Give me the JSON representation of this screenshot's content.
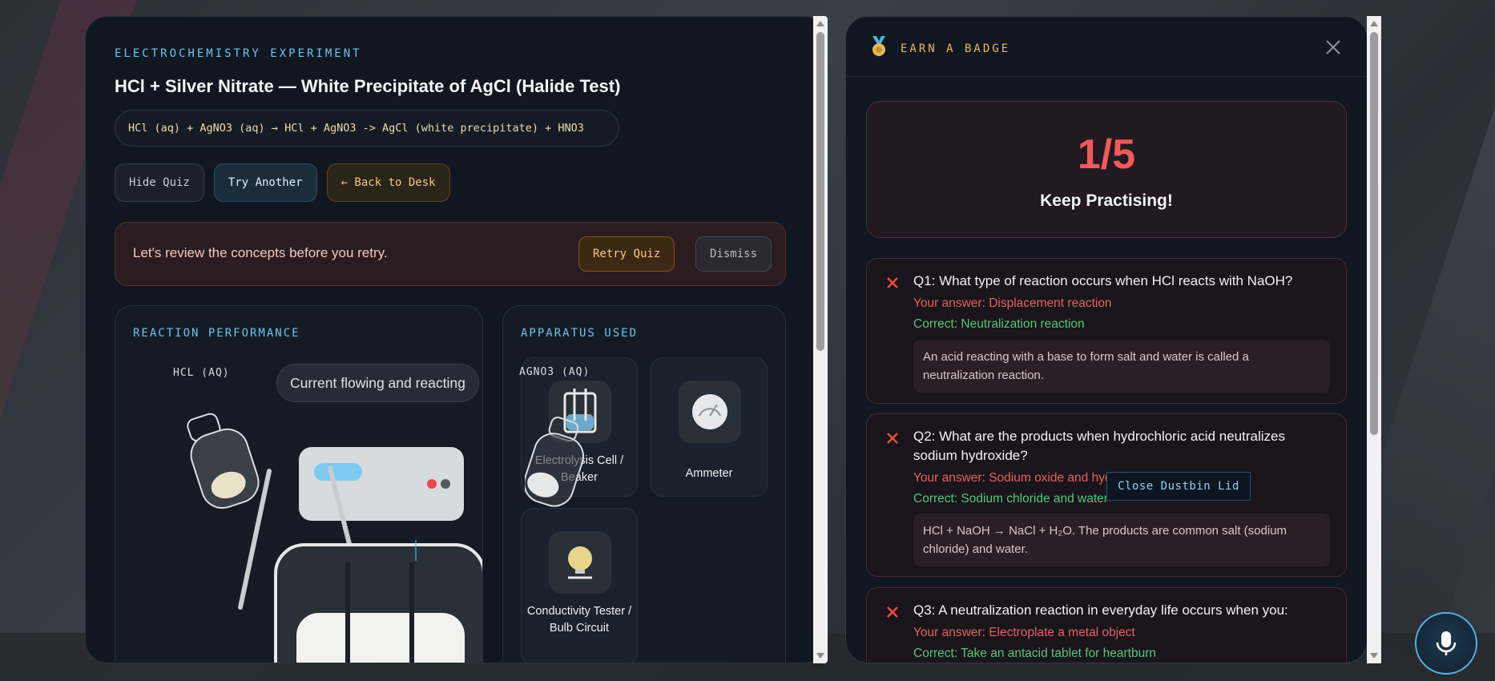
{
  "experiment": {
    "eyebrow": "ELECTROCHEMISTRY EXPERIMENT",
    "title": "HCl + Silver Nitrate — White Precipitate of AgCl (Halide Test)",
    "equation": "HCl (aq) + AgNO3 (aq) → HCl + AgNO3 -> AgCl (white precipitate) + HNO3",
    "buttons": {
      "hide_quiz": "Hide Quiz",
      "try_another": "Try Another",
      "back_to_desk": "← Back to Desk"
    },
    "alert": {
      "text": "Let's review the concepts before you retry.",
      "retry": "Retry Quiz",
      "dismiss": "Dismiss"
    },
    "performance": {
      "heading": "REACTION PERFORMANCE",
      "left_label": "HCL (AQ)",
      "right_label": "AGNO3 (AQ)",
      "status": "Current flowing and reacting"
    },
    "apparatus": {
      "heading": "APPARATUS USED",
      "items": [
        {
          "label": "Electrolysis Cell / Beaker",
          "icon": "electrolysis-cell-icon"
        },
        {
          "label": "Ammeter",
          "icon": "ammeter-icon"
        },
        {
          "label": "Conductivity Tester / Bulb Circuit",
          "icon": "bulb-circuit-icon"
        }
      ]
    }
  },
  "quiz": {
    "header": "EARN A BADGE",
    "score": "1/5",
    "score_message": "Keep Practising!",
    "questions": [
      {
        "question": "Q1: What type of reaction occurs when HCl reacts with NaOH?",
        "your_answer": "Your answer: Displacement reaction",
        "correct": "Correct: Neutralization reaction",
        "explanation": "An acid reacting with a base to form salt and water is called a neutralization reaction."
      },
      {
        "question": "Q2: What are the products when hydrochloric acid neutralizes sodium hydroxide?",
        "your_answer": "Your answer: Sodium oxide and hydrogen",
        "correct": "Correct: Sodium chloride and water",
        "explanation": "HCl + NaOH → NaCl + H₂O. The products are common salt (sodium chloride) and water."
      },
      {
        "question": "Q3: A neutralization reaction in everyday life occurs when you:",
        "your_answer": "Your answer: Electroplate a metal object",
        "correct": "Correct: Take an antacid tablet for heartburn"
      }
    ]
  },
  "tooltip": "Close Dustbin Lid",
  "colors": {
    "accent_blue": "#6ec3e8",
    "score_red": "#ef5a5a",
    "correct_green": "#55c77a",
    "badge_gold": "#e8b85c"
  }
}
